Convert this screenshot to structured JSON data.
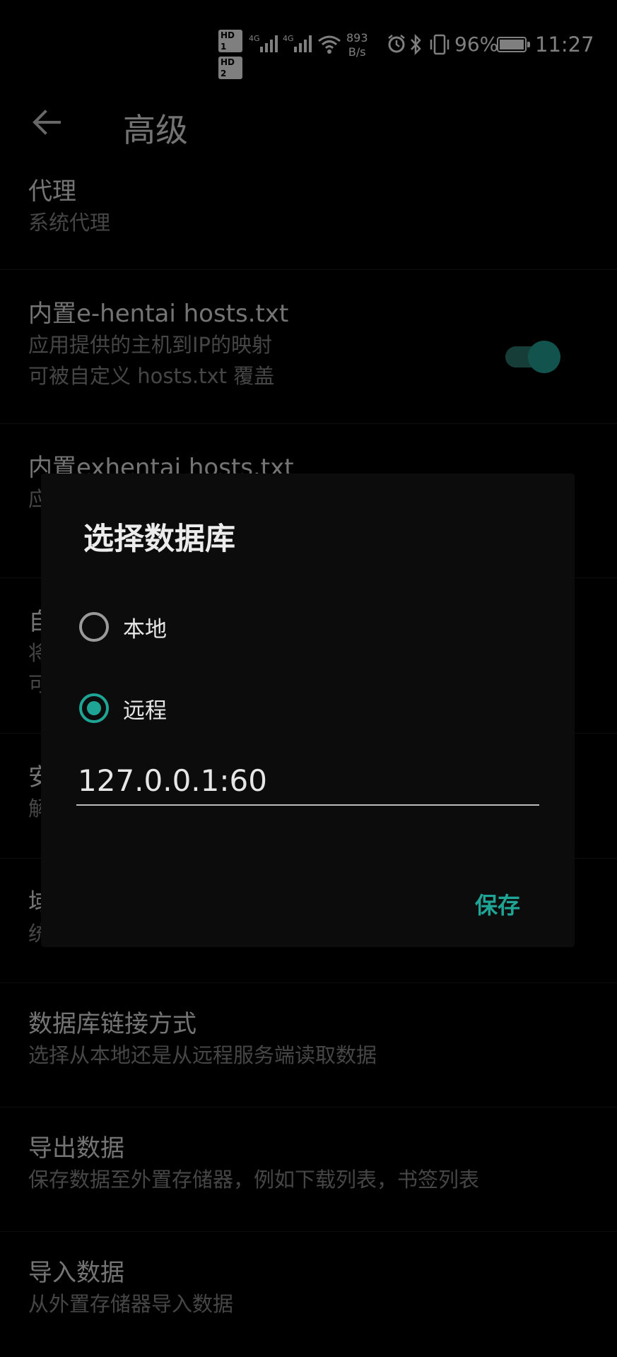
{
  "status_bar": {
    "hd1": "HD 1",
    "hd2": "HD 2",
    "net1": "4G",
    "net2": "4G",
    "speed_value": "893",
    "speed_unit": "B/s",
    "battery_percent": "96%",
    "battery_level": 0.96,
    "time": "11:27",
    "icons": [
      "alarm-icon",
      "bluetooth-icon",
      "vibrate-icon",
      "wifi-icon",
      "signal-icon"
    ]
  },
  "app_bar": {
    "title": "高级",
    "back_icon": "arrow-left-icon"
  },
  "settings": [
    {
      "title": "代理",
      "summary": "系统代理"
    },
    {
      "title": "内置e-hentai hosts.txt",
      "summary": "应用提供的主机到IP的映射\n可被自定义 hosts.txt 覆盖",
      "toggle_on": true
    },
    {
      "title": "内置exhentai hosts.txt",
      "summary": "应"
    },
    {
      "title": "自",
      "summary": "将\n可"
    },
    {
      "title": "安",
      "summary": "解"
    },
    {
      "title": "域",
      "summary": "统"
    },
    {
      "title": "数据库链接方式",
      "summary": "选择从本地还是从远程服务端读取数据"
    },
    {
      "title": "导出数据",
      "summary": "保存数据至外置存储器，例如下载列表，书签列表"
    },
    {
      "title": "导入数据",
      "summary": "从外置存储器导入数据"
    }
  ],
  "dialog": {
    "title": "选择数据库",
    "options": [
      {
        "label": "本地",
        "checked": false
      },
      {
        "label": "远程",
        "checked": true
      }
    ],
    "address_value": "127.0.0.1:60",
    "save_label": "保存"
  },
  "colors": {
    "accent": "#1fa595",
    "background": "#000000",
    "dialog_bg": "#0c0c0c"
  }
}
